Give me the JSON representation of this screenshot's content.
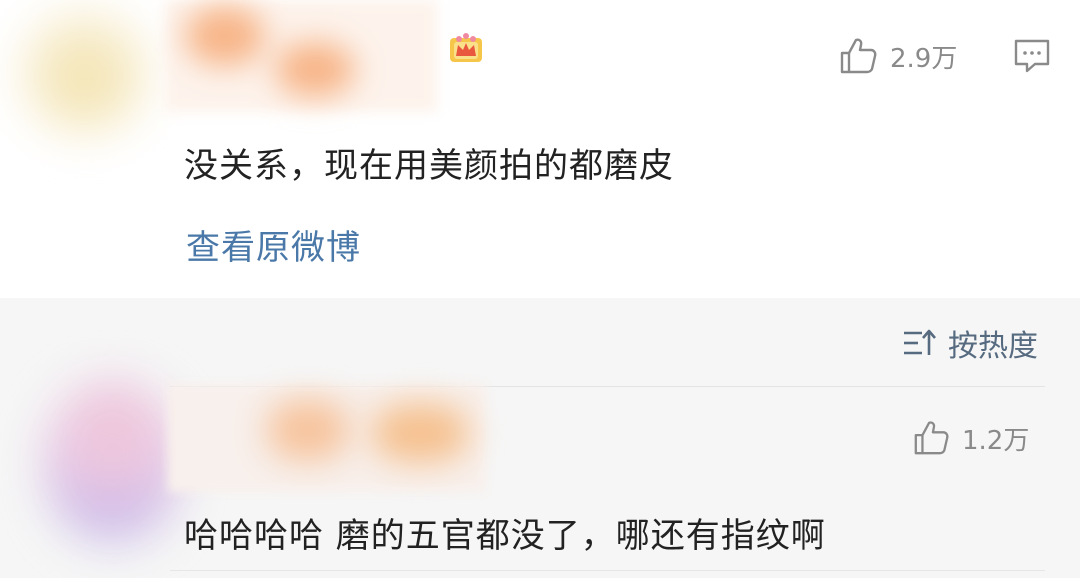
{
  "top_comment": {
    "likes": "2.9万",
    "text": "没关系，现在用美颜拍的都磨皮",
    "view_original_link": "查看原微博",
    "icons": {
      "like": "thumbs-up-icon",
      "comment": "comment-icon",
      "badge": "crown-badge-icon"
    }
  },
  "sort": {
    "label": "按热度",
    "icon": "sort-icon"
  },
  "reply": {
    "likes": "1.2万",
    "text": "哈哈哈哈 磨的五官都没了，哪还有指纹啊",
    "icons": {
      "like": "thumbs-up-icon"
    }
  },
  "colors": {
    "link": "#4a78a8",
    "meta_gray": "#8a8a8a",
    "sort_text": "#566a80",
    "body_text": "#222222"
  }
}
